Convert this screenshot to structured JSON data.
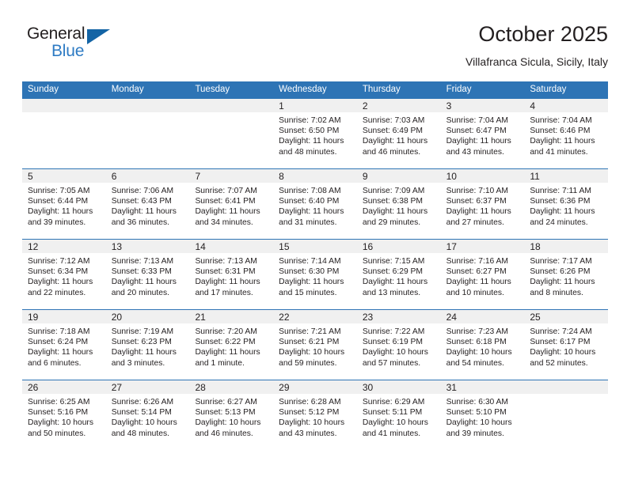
{
  "brand": {
    "name_part1": "General",
    "name_part2": "Blue",
    "logo_icon": "blue-triangle-flag",
    "color_primary": "#1464a5",
    "color_secondary": "#2e7bc4"
  },
  "header": {
    "title": "October 2025",
    "subtitle": "Villafranca Sicula, Sicily, Italy"
  },
  "theme": {
    "header_row_bg": "#2e74b5",
    "day_band_bg": "#f0f0f0",
    "row_divider": "#2e74b5",
    "text": "#231f20"
  },
  "weekdays": [
    "Sunday",
    "Monday",
    "Tuesday",
    "Wednesday",
    "Thursday",
    "Friday",
    "Saturday"
  ],
  "weeks": [
    [
      {
        "day": "",
        "sunrise": "",
        "sunset": "",
        "daylight": ""
      },
      {
        "day": "",
        "sunrise": "",
        "sunset": "",
        "daylight": ""
      },
      {
        "day": "",
        "sunrise": "",
        "sunset": "",
        "daylight": ""
      },
      {
        "day": "1",
        "sunrise": "Sunrise: 7:02 AM",
        "sunset": "Sunset: 6:50 PM",
        "daylight": "Daylight: 11 hours and 48 minutes."
      },
      {
        "day": "2",
        "sunrise": "Sunrise: 7:03 AM",
        "sunset": "Sunset: 6:49 PM",
        "daylight": "Daylight: 11 hours and 46 minutes."
      },
      {
        "day": "3",
        "sunrise": "Sunrise: 7:04 AM",
        "sunset": "Sunset: 6:47 PM",
        "daylight": "Daylight: 11 hours and 43 minutes."
      },
      {
        "day": "4",
        "sunrise": "Sunrise: 7:04 AM",
        "sunset": "Sunset: 6:46 PM",
        "daylight": "Daylight: 11 hours and 41 minutes."
      }
    ],
    [
      {
        "day": "5",
        "sunrise": "Sunrise: 7:05 AM",
        "sunset": "Sunset: 6:44 PM",
        "daylight": "Daylight: 11 hours and 39 minutes."
      },
      {
        "day": "6",
        "sunrise": "Sunrise: 7:06 AM",
        "sunset": "Sunset: 6:43 PM",
        "daylight": "Daylight: 11 hours and 36 minutes."
      },
      {
        "day": "7",
        "sunrise": "Sunrise: 7:07 AM",
        "sunset": "Sunset: 6:41 PM",
        "daylight": "Daylight: 11 hours and 34 minutes."
      },
      {
        "day": "8",
        "sunrise": "Sunrise: 7:08 AM",
        "sunset": "Sunset: 6:40 PM",
        "daylight": "Daylight: 11 hours and 31 minutes."
      },
      {
        "day": "9",
        "sunrise": "Sunrise: 7:09 AM",
        "sunset": "Sunset: 6:38 PM",
        "daylight": "Daylight: 11 hours and 29 minutes."
      },
      {
        "day": "10",
        "sunrise": "Sunrise: 7:10 AM",
        "sunset": "Sunset: 6:37 PM",
        "daylight": "Daylight: 11 hours and 27 minutes."
      },
      {
        "day": "11",
        "sunrise": "Sunrise: 7:11 AM",
        "sunset": "Sunset: 6:36 PM",
        "daylight": "Daylight: 11 hours and 24 minutes."
      }
    ],
    [
      {
        "day": "12",
        "sunrise": "Sunrise: 7:12 AM",
        "sunset": "Sunset: 6:34 PM",
        "daylight": "Daylight: 11 hours and 22 minutes."
      },
      {
        "day": "13",
        "sunrise": "Sunrise: 7:13 AM",
        "sunset": "Sunset: 6:33 PM",
        "daylight": "Daylight: 11 hours and 20 minutes."
      },
      {
        "day": "14",
        "sunrise": "Sunrise: 7:13 AM",
        "sunset": "Sunset: 6:31 PM",
        "daylight": "Daylight: 11 hours and 17 minutes."
      },
      {
        "day": "15",
        "sunrise": "Sunrise: 7:14 AM",
        "sunset": "Sunset: 6:30 PM",
        "daylight": "Daylight: 11 hours and 15 minutes."
      },
      {
        "day": "16",
        "sunrise": "Sunrise: 7:15 AM",
        "sunset": "Sunset: 6:29 PM",
        "daylight": "Daylight: 11 hours and 13 minutes."
      },
      {
        "day": "17",
        "sunrise": "Sunrise: 7:16 AM",
        "sunset": "Sunset: 6:27 PM",
        "daylight": "Daylight: 11 hours and 10 minutes."
      },
      {
        "day": "18",
        "sunrise": "Sunrise: 7:17 AM",
        "sunset": "Sunset: 6:26 PM",
        "daylight": "Daylight: 11 hours and 8 minutes."
      }
    ],
    [
      {
        "day": "19",
        "sunrise": "Sunrise: 7:18 AM",
        "sunset": "Sunset: 6:24 PM",
        "daylight": "Daylight: 11 hours and 6 minutes."
      },
      {
        "day": "20",
        "sunrise": "Sunrise: 7:19 AM",
        "sunset": "Sunset: 6:23 PM",
        "daylight": "Daylight: 11 hours and 3 minutes."
      },
      {
        "day": "21",
        "sunrise": "Sunrise: 7:20 AM",
        "sunset": "Sunset: 6:22 PM",
        "daylight": "Daylight: 11 hours and 1 minute."
      },
      {
        "day": "22",
        "sunrise": "Sunrise: 7:21 AM",
        "sunset": "Sunset: 6:21 PM",
        "daylight": "Daylight: 10 hours and 59 minutes."
      },
      {
        "day": "23",
        "sunrise": "Sunrise: 7:22 AM",
        "sunset": "Sunset: 6:19 PM",
        "daylight": "Daylight: 10 hours and 57 minutes."
      },
      {
        "day": "24",
        "sunrise": "Sunrise: 7:23 AM",
        "sunset": "Sunset: 6:18 PM",
        "daylight": "Daylight: 10 hours and 54 minutes."
      },
      {
        "day": "25",
        "sunrise": "Sunrise: 7:24 AM",
        "sunset": "Sunset: 6:17 PM",
        "daylight": "Daylight: 10 hours and 52 minutes."
      }
    ],
    [
      {
        "day": "26",
        "sunrise": "Sunrise: 6:25 AM",
        "sunset": "Sunset: 5:16 PM",
        "daylight": "Daylight: 10 hours and 50 minutes."
      },
      {
        "day": "27",
        "sunrise": "Sunrise: 6:26 AM",
        "sunset": "Sunset: 5:14 PM",
        "daylight": "Daylight: 10 hours and 48 minutes."
      },
      {
        "day": "28",
        "sunrise": "Sunrise: 6:27 AM",
        "sunset": "Sunset: 5:13 PM",
        "daylight": "Daylight: 10 hours and 46 minutes."
      },
      {
        "day": "29",
        "sunrise": "Sunrise: 6:28 AM",
        "sunset": "Sunset: 5:12 PM",
        "daylight": "Daylight: 10 hours and 43 minutes."
      },
      {
        "day": "30",
        "sunrise": "Sunrise: 6:29 AM",
        "sunset": "Sunset: 5:11 PM",
        "daylight": "Daylight: 10 hours and 41 minutes."
      },
      {
        "day": "31",
        "sunrise": "Sunrise: 6:30 AM",
        "sunset": "Sunset: 5:10 PM",
        "daylight": "Daylight: 10 hours and 39 minutes."
      },
      {
        "day": "",
        "sunrise": "",
        "sunset": "",
        "daylight": ""
      }
    ]
  ]
}
